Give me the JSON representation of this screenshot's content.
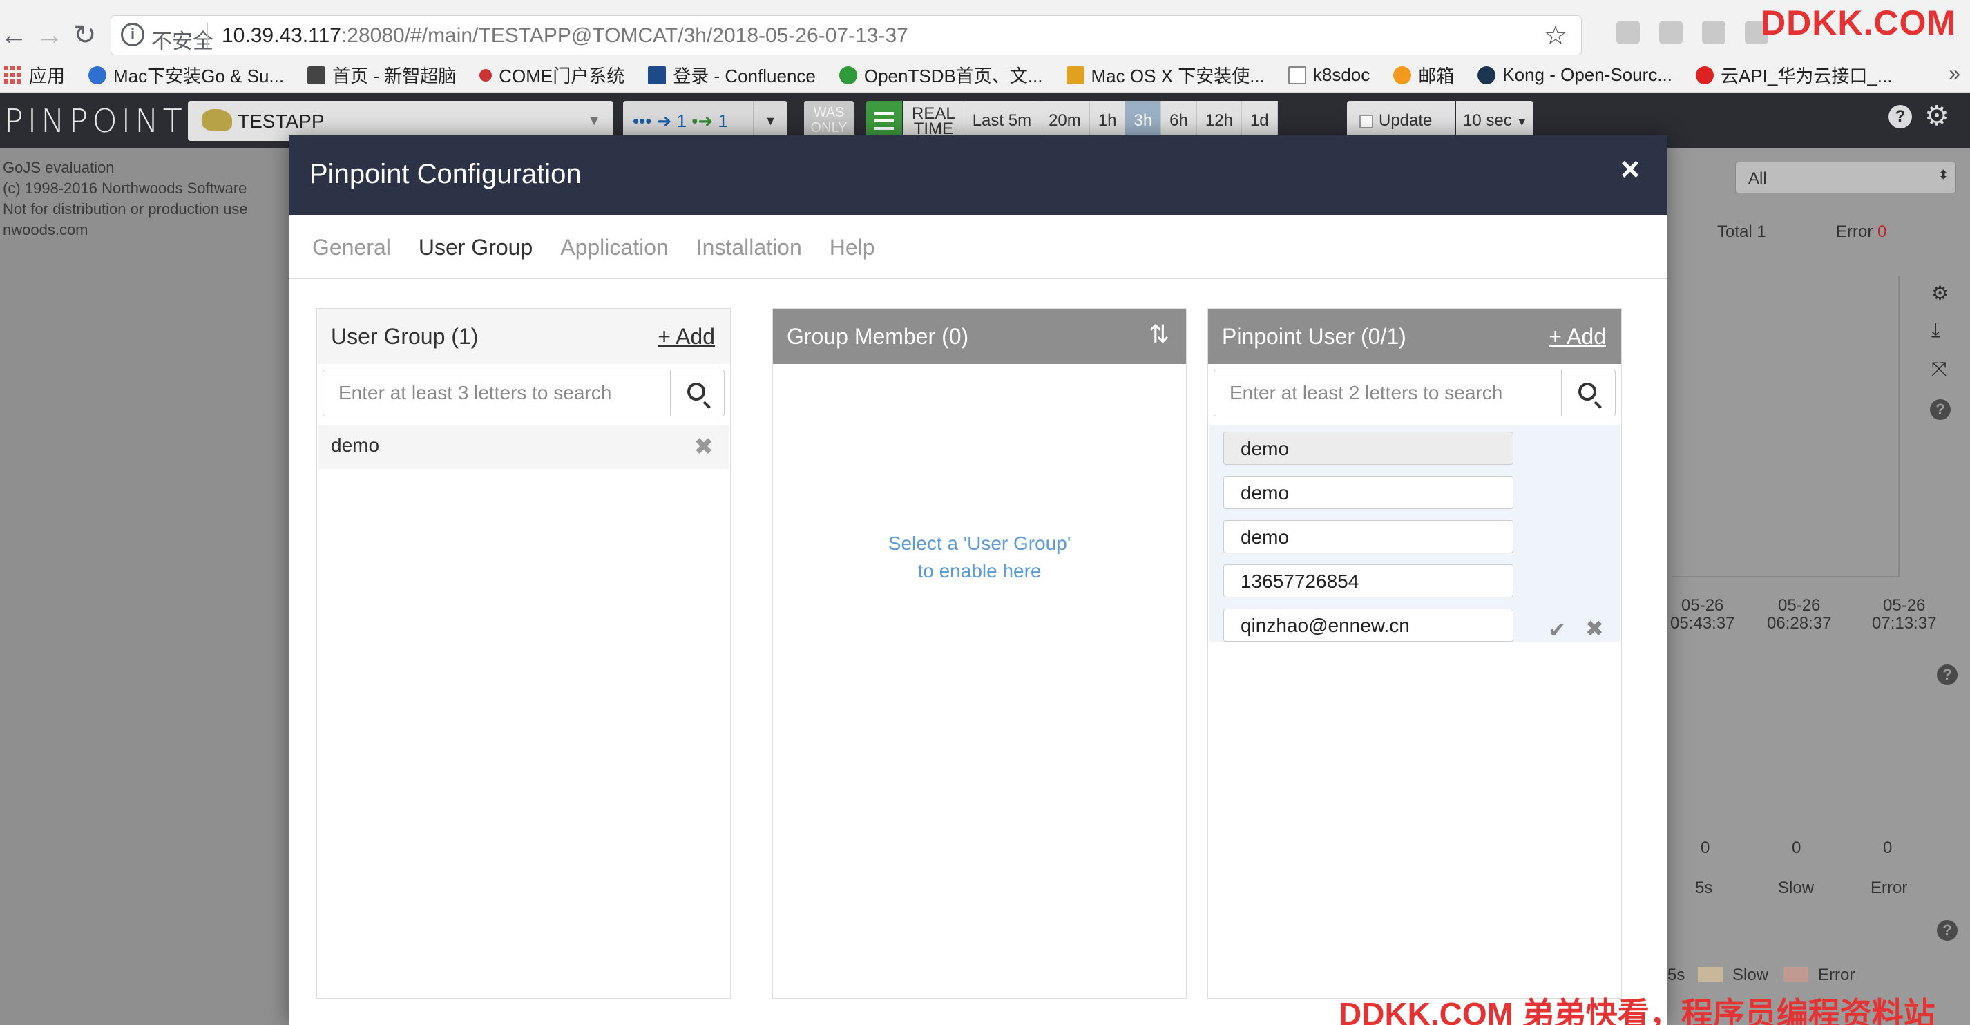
{
  "browser": {
    "insecure_label": "不安全",
    "url_host": "10.39.43.117",
    "url_rest": ":28080/#/main/TESTAPP@TOMCAT/3h/2018-05-26-07-13-37",
    "watermark_top": "DDKK.COM",
    "bookmarks": [
      {
        "label": "应用",
        "icon": "apps-grid-icon"
      },
      {
        "label": "Mac下安装Go & Su...",
        "icon": "c-logo-icon"
      },
      {
        "label": "首页 - 新智超脑",
        "icon": "edit-icon"
      },
      {
        "label": "COME门户系统",
        "icon": "come-logo-icon"
      },
      {
        "label": "登录 - Confluence",
        "icon": "confluence-icon"
      },
      {
        "label": "OpenTSDB首页、文...",
        "icon": "c-logo-icon"
      },
      {
        "label": "Mac OS X 下安装使...",
        "icon": "edit-icon"
      },
      {
        "label": "k8sdoc",
        "icon": "document-icon"
      },
      {
        "label": "邮箱",
        "icon": "mail-icon"
      },
      {
        "label": "Kong - Open-Sourc...",
        "icon": "kong-icon"
      },
      {
        "label": "云API_华为云接口_...",
        "icon": "huawei-icon"
      }
    ],
    "more": "»"
  },
  "appbar": {
    "logo": "PINPOINT",
    "application": "TESTAPP",
    "inbound": "1",
    "outbound": "1",
    "was_only": [
      "WAS",
      "ONLY"
    ],
    "real_time": [
      "REAL",
      "TIME"
    ],
    "ranges": [
      "Last 5m",
      "20m",
      "1h",
      "3h",
      "6h",
      "12h",
      "1d"
    ],
    "active_range": "3h",
    "update_label": "Update",
    "refresh_interval": "10 sec"
  },
  "background": {
    "gojs_notice": "GoJS evaluation\n(c) 1998-2016 Northwoods Software\nNot for distribution or production use\nnwoods.com",
    "agent_filter": "All",
    "total_label": "Total",
    "total_value": "1",
    "error_label": "Error",
    "error_value": "0",
    "time_ticks": [
      {
        "date": "05-26",
        "time": "05:43:37"
      },
      {
        "date": "05-26",
        "time": "06:28:37"
      },
      {
        "date": "05-26",
        "time": "07:13:37"
      }
    ],
    "counts": [
      {
        "value": "0",
        "label": "5s"
      },
      {
        "value": "0",
        "label": "Slow"
      },
      {
        "value": "0",
        "label": "Error"
      }
    ],
    "legend": [
      {
        "label": "5s",
        "color": "#9a9a9a"
      },
      {
        "label": "Slow",
        "color": "#c9b79a"
      },
      {
        "label": "Error",
        "color": "#c09a90"
      }
    ]
  },
  "modal": {
    "title": "Pinpoint Configuration",
    "close": "×",
    "tabs": [
      "General",
      "User Group",
      "Application",
      "Installation",
      "Help"
    ],
    "active_tab": "User Group",
    "user_group": {
      "title": "User Group (1)",
      "add": "+ Add",
      "search_placeholder": "Enter at least 3 letters to search",
      "items": [
        "demo"
      ]
    },
    "group_member": {
      "title": "Group Member (0)",
      "empty_line1": "Select a 'User Group'",
      "empty_line2": "to enable here"
    },
    "pinpoint_user": {
      "title": "Pinpoint User (0/1)",
      "add": "+ Add",
      "search_placeholder": "Enter at least 2 letters to search",
      "form_fields": [
        "demo",
        "demo",
        "demo",
        "13657726854",
        "qinzhao@ennew.cn"
      ]
    }
  },
  "watermark_bottom": "DDKK.COM 弟弟快看，程序员编程资料站",
  "colors": {
    "modal_header": "#2d3347",
    "panel_header_gray": "#8e8e8e",
    "link_blue": "#5a9bd8",
    "watermark_red": "#e53232"
  }
}
